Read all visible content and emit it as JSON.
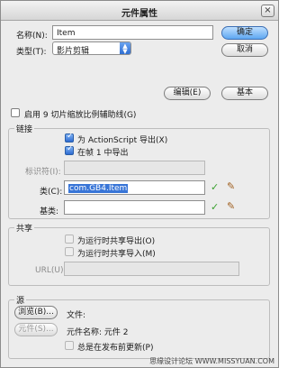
{
  "window": {
    "title": "元件属性",
    "close": "×"
  },
  "name_field": {
    "label": "名称(N):",
    "value": "Item"
  },
  "type_field": {
    "label": "类型(T):",
    "value": "影片剪辑"
  },
  "buttons": {
    "ok": "确定",
    "cancel": "取消",
    "edit": "编辑(E)",
    "basic": "基本"
  },
  "guides_checkbox": {
    "label": "启用 9 切片缩放比例辅助线(G)",
    "checked": false
  },
  "linkage": {
    "title": "链接",
    "export_actionscript": {
      "label": "为 ActionScript 导出(X)",
      "checked": true
    },
    "export_first_frame": {
      "label": "在帧 1 中导出",
      "checked": true
    },
    "identifier": {
      "label": "标识符(I):",
      "value": ""
    },
    "class": {
      "label": "类(C):",
      "value": "com.GB4.Item"
    },
    "base_class": {
      "label": "基类:",
      "value": ""
    }
  },
  "sharing": {
    "title": "共享",
    "export_runtime": {
      "label": "为运行时共享导出(O)",
      "checked": false
    },
    "import_runtime": {
      "label": "为运行时共享导入(M)",
      "checked": false
    },
    "url": {
      "label": "URL(U):",
      "value": ""
    }
  },
  "source": {
    "title": "源",
    "browse_button": "浏览(B)...",
    "symbol_button": "元件(S)...",
    "file_label": "文件:",
    "symbol_name_label": "元件名称: 元件 2",
    "update_checkbox": {
      "label": "总是在发布前更新(P)",
      "checked": false
    }
  },
  "watermark": "思缘设计论坛 WWW.MISSYUAN.COM",
  "colors": {
    "validate_check": "#3aa12f",
    "selection": "#3875d7",
    "primary_button": "#5ea7f2"
  },
  "icons": {
    "validate": "check-icon",
    "edit_class": "pencil-icon",
    "close": "close-icon"
  }
}
